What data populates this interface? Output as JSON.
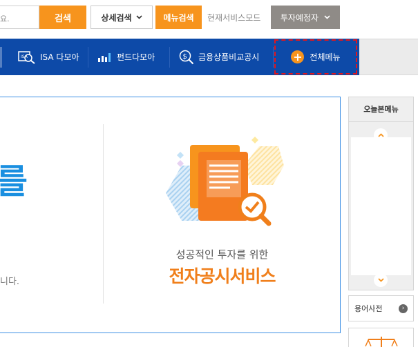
{
  "search": {
    "placeholder_tail": "요.",
    "button_label": "검색",
    "detail_label": "상세검색",
    "menu_search_label": "메뉴검색",
    "mode_label": "현재서비스모드",
    "mode_value": "투자예정자"
  },
  "nav": {
    "items": [
      {
        "label": "ISA 다모아",
        "icon": "isa-search-icon"
      },
      {
        "label": "펀드다모아",
        "icon": "bar-chart-icon"
      },
      {
        "label": "금융상품비교공시",
        "icon": "money-search-icon"
      }
    ],
    "all_menu_label": "전체메뉴",
    "all_menu_icon": "plus-circle-icon"
  },
  "main": {
    "big_char": "를",
    "left_text": "니다.",
    "promo_sub": "성공적인 투자를 위한",
    "promo_main": "전자공시서비스"
  },
  "side": {
    "recent_title": "오늘본메뉴",
    "dict_label": "용어사전"
  },
  "colors": {
    "accent_orange": "#f7941d",
    "nav_blue": "#0d4aa8",
    "title_blue": "#1a8fe0",
    "promo_orange": "#f07f1b",
    "focus_red": "#e2161d"
  }
}
